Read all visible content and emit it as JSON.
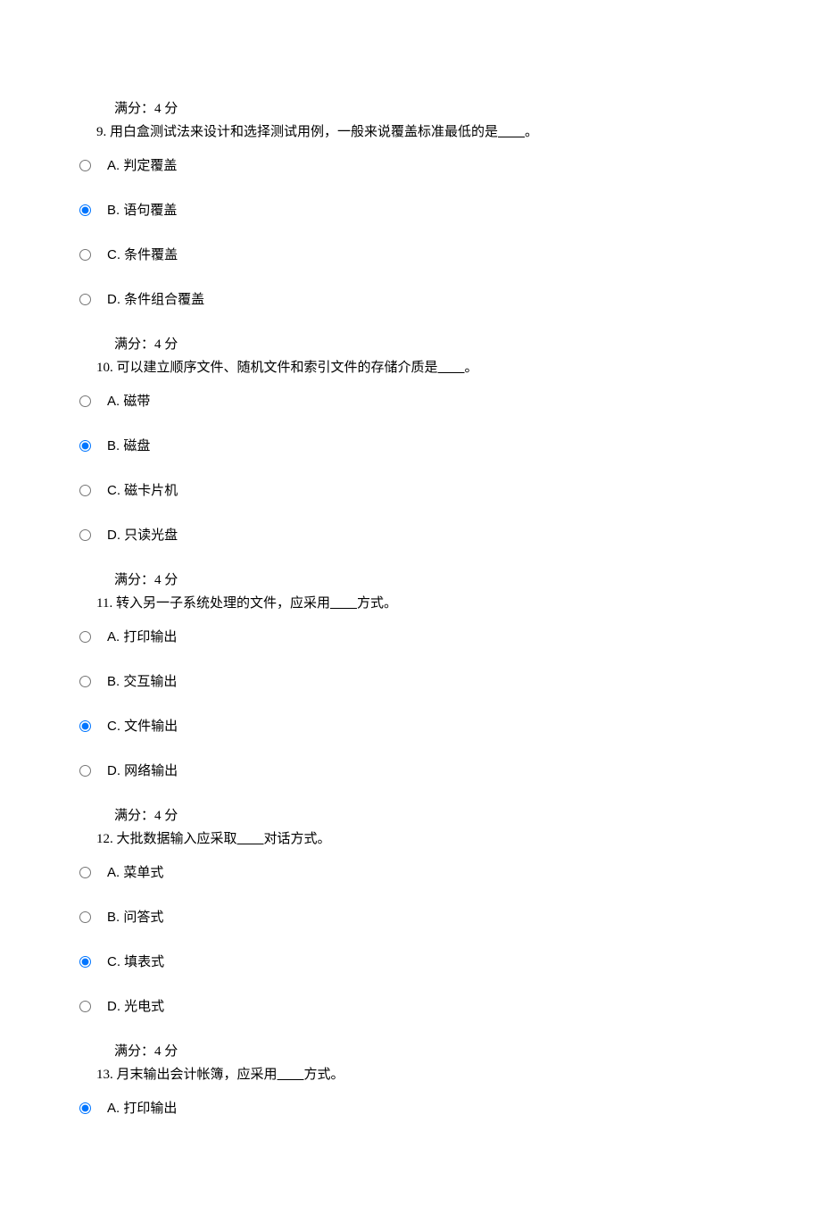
{
  "score_label": "满分：4 分",
  "questions": [
    {
      "number": "9.",
      "text_before": "用白盒测试法来设计和选择测试用例，一般来说覆盖标准最低的是",
      "text_after": "。",
      "options": [
        {
          "letter": "A.",
          "text": "判定覆盖",
          "selected": false
        },
        {
          "letter": "B.",
          "text": "语句覆盖",
          "selected": true
        },
        {
          "letter": "C.",
          "text": "条件覆盖",
          "selected": false
        },
        {
          "letter": "D.",
          "text": "条件组合覆盖",
          "selected": false
        }
      ]
    },
    {
      "number": "10.",
      "text_before": "可以建立顺序文件、随机文件和索引文件的存储介质是",
      "text_after": "。",
      "options": [
        {
          "letter": "A.",
          "text": "磁带",
          "selected": false
        },
        {
          "letter": "B.",
          "text": "磁盘",
          "selected": true
        },
        {
          "letter": "C.",
          "text": "磁卡片机",
          "selected": false
        },
        {
          "letter": "D.",
          "text": "只读光盘",
          "selected": false
        }
      ]
    },
    {
      "number": "11.",
      "text_before": "转入另一子系统处理的文件，应采用",
      "text_after": "方式。",
      "options": [
        {
          "letter": "A.",
          "text": "打印输出",
          "selected": false
        },
        {
          "letter": "B.",
          "text": "交互输出",
          "selected": false
        },
        {
          "letter": "C.",
          "text": "文件输出",
          "selected": true
        },
        {
          "letter": "D.",
          "text": "网络输出",
          "selected": false
        }
      ]
    },
    {
      "number": "12.",
      "text_before": "大批数据输入应采取",
      "text_after": "对话方式。",
      "options": [
        {
          "letter": "A.",
          "text": "菜单式",
          "selected": false
        },
        {
          "letter": "B.",
          "text": "问答式",
          "selected": false
        },
        {
          "letter": "C.",
          "text": "填表式",
          "selected": true
        },
        {
          "letter": "D.",
          "text": "光电式",
          "selected": false
        }
      ]
    },
    {
      "number": "13.",
      "text_before": "月末输出会计帐簿，应采用",
      "text_after": "方式。",
      "options": [
        {
          "letter": "A.",
          "text": "打印输出",
          "selected": true
        }
      ]
    }
  ]
}
